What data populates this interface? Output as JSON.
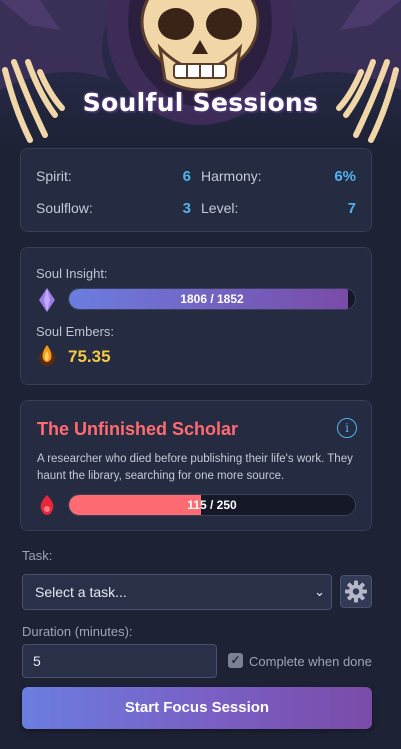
{
  "app": {
    "title": "Soulful Sessions"
  },
  "stats": {
    "spirit_label": "Spirit:",
    "spirit_value": "6",
    "harmony_label": "Harmony:",
    "harmony_value": "6%",
    "soulflow_label": "Soulflow:",
    "soulflow_value": "3",
    "level_label": "Level:",
    "level_value": "7"
  },
  "insight": {
    "label": "Soul Insight:",
    "current": 1806,
    "max": 1852,
    "text": "1806 / 1852",
    "color_start": "#6b7de0",
    "color_end": "#7a4ba8"
  },
  "embers": {
    "label": "Soul Embers:",
    "value": "75.35",
    "color": "#f6c945"
  },
  "ghost": {
    "name": "The Unfinished Scholar",
    "description": "A researcher who died before publishing their life's work. They haunt the library, searching for one more source.",
    "current": 115,
    "max": 250,
    "text": "115 / 250",
    "color": "#ff6b72",
    "info_icon": "info-icon"
  },
  "task": {
    "label": "Task:",
    "selected": "Select a task...",
    "settings_icon": "gear-icon"
  },
  "duration": {
    "label": "Duration (minutes):",
    "value": "5"
  },
  "complete_when_done": {
    "label": "Complete when done",
    "checked": true
  },
  "start_button": {
    "label": "Start Focus Session"
  }
}
